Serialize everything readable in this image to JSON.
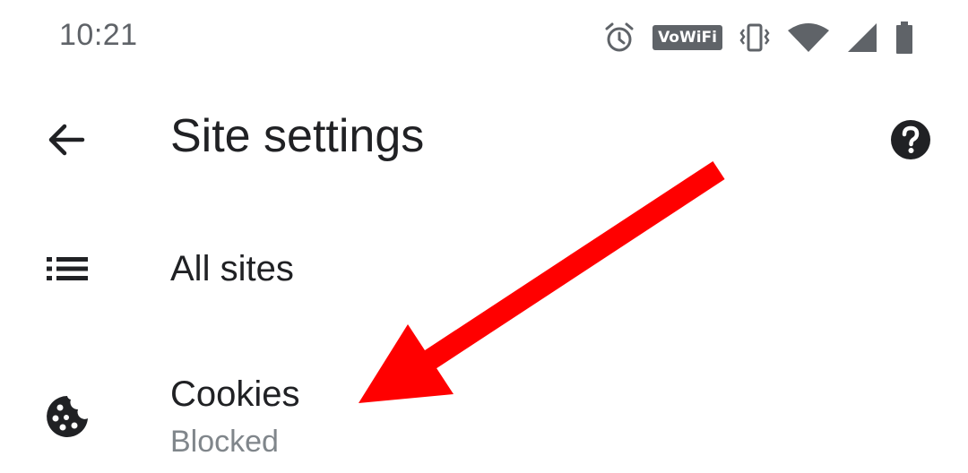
{
  "status_bar": {
    "time": "10:21",
    "network_badge": "VoWiFi",
    "icons": [
      "alarm-icon",
      "vowifi-icon",
      "vibrate-icon",
      "wifi-icon",
      "cell-signal-icon",
      "battery-icon"
    ]
  },
  "toolbar": {
    "title": "Site settings",
    "back_icon": "arrow-back-icon",
    "help_icon": "help-icon"
  },
  "settings_list": {
    "items": [
      {
        "title": "All sites",
        "icon": "list-icon"
      },
      {
        "title": "Cookies",
        "subtitle": "Blocked",
        "icon": "cookie-icon"
      }
    ]
  },
  "annotation": {
    "arrow_color": "#ff0000"
  },
  "colors": {
    "text_primary": "#202124",
    "text_secondary": "#80868b",
    "icon_gray": "#5f6368",
    "icon_dark": "#3c4043"
  }
}
